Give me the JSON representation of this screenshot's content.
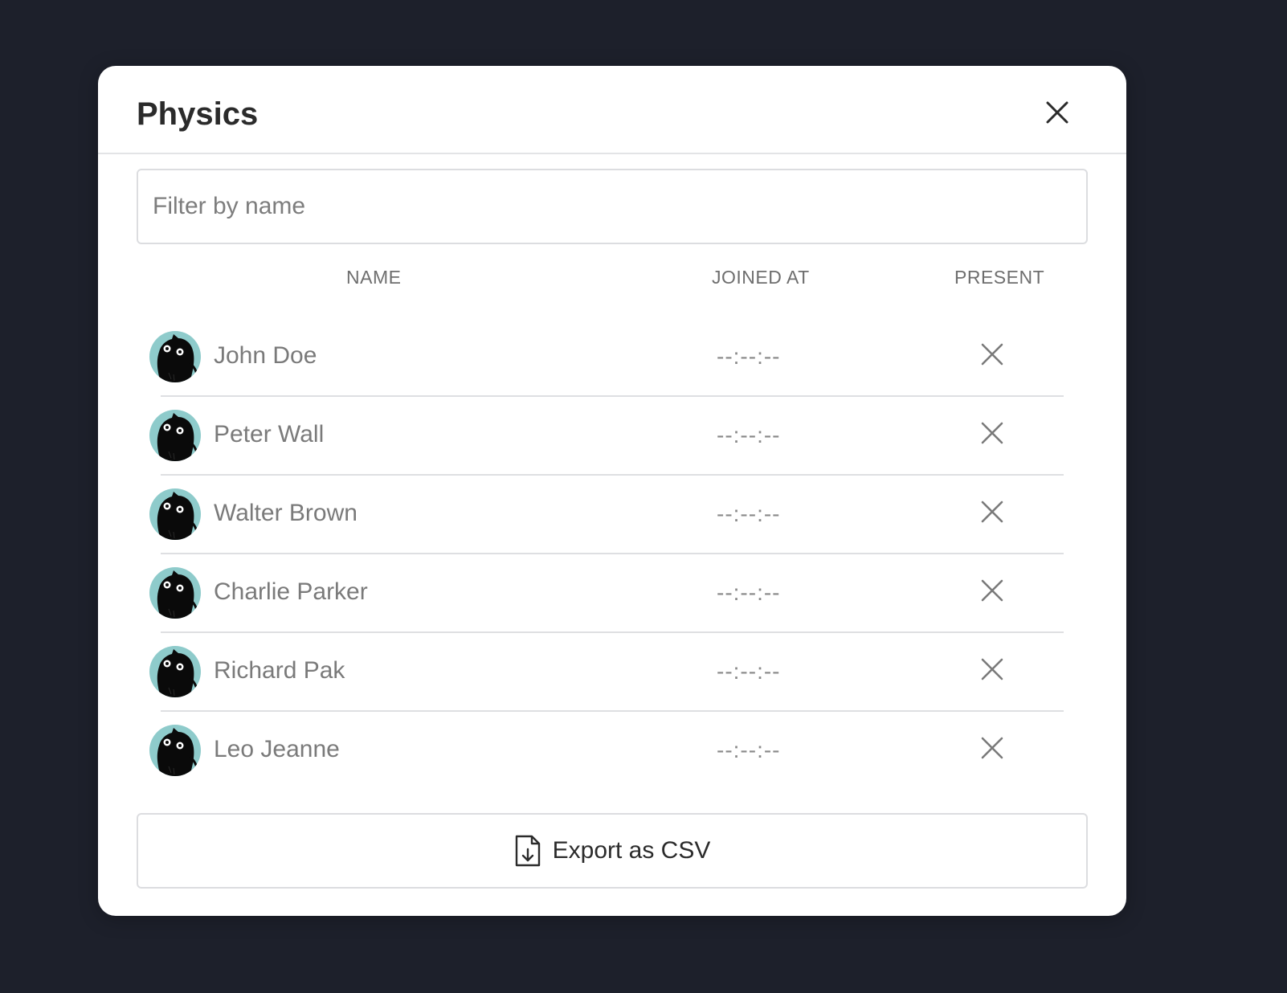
{
  "dialog": {
    "title": "Physics",
    "close_icon": "close-icon"
  },
  "filter": {
    "placeholder": "Filter by name",
    "value": ""
  },
  "table": {
    "columns": [
      "NAME",
      "JOINED AT",
      "PRESENT"
    ],
    "rows": [
      {
        "name": "John Doe",
        "joined_at": "--:--:--",
        "present": false
      },
      {
        "name": "Peter Wall",
        "joined_at": "--:--:--",
        "present": false
      },
      {
        "name": "Walter Brown",
        "joined_at": "--:--:--",
        "present": false
      },
      {
        "name": "Charlie Parker",
        "joined_at": "--:--:--",
        "present": false
      },
      {
        "name": "Richard Pak",
        "joined_at": "--:--:--",
        "present": false
      },
      {
        "name": "Leo Jeanne",
        "joined_at": "--:--:--",
        "present": false
      }
    ]
  },
  "export": {
    "label": "Export as CSV",
    "icon": "file-download-icon"
  },
  "colors": {
    "backdrop": "#1d202b",
    "avatar_bg": "#8ecbcb"
  }
}
